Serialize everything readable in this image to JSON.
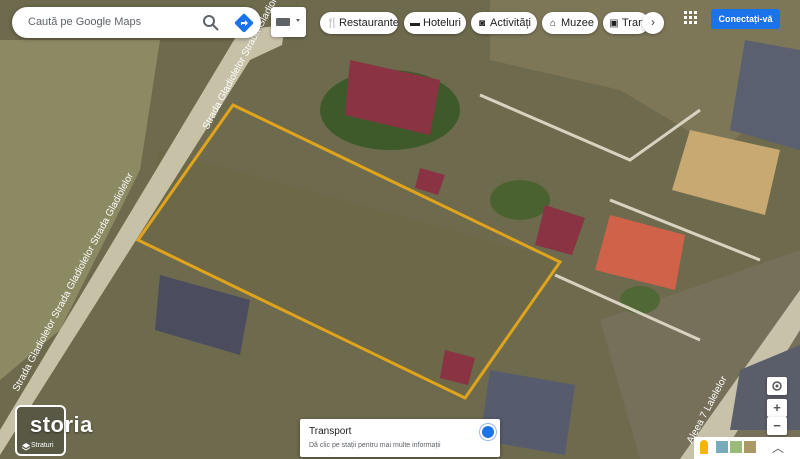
{
  "search": {
    "placeholder": "Caută pe Google Maps"
  },
  "categories": [
    {
      "label": "Restaurante",
      "icon": "fork-knife-icon"
    },
    {
      "label": "Hoteluri",
      "icon": "bed-icon"
    },
    {
      "label": "Activități",
      "icon": "camera-icon"
    },
    {
      "label": "Muzee",
      "icon": "museum-icon"
    },
    {
      "label": "Trans",
      "icon": "transit-icon"
    }
  ],
  "header": {
    "signin_label": "Conectați-vă"
  },
  "layers": {
    "label": "Straturi"
  },
  "watermark": {
    "text": "storia"
  },
  "transport": {
    "title": "Transport",
    "description": "Dă clic pe stații pentru mai multe informații",
    "enabled": true
  },
  "street_labels": {
    "street_left": "Strada Gladiolelor Strada Gladiolelor Strada Gladiolelor",
    "street_top": "Strada Gladiolelor Strada Gladiolelor",
    "street_right": "Aleea 7 Lalelelor"
  },
  "colors": {
    "accent": "#1a73e8",
    "parcel_outline": "#e0a41c"
  },
  "zoom_controls": {
    "in": "+",
    "out": "−"
  }
}
